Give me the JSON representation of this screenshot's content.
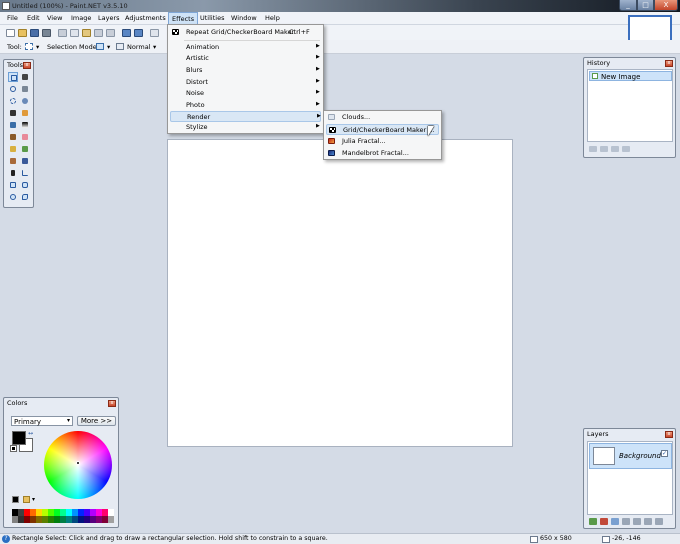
{
  "window": {
    "title": "Untitled (100%) - Paint.NET v3.5.10",
    "buttons": {
      "minimize": "_",
      "maximize": "□",
      "close": "X"
    }
  },
  "menubar": {
    "items": [
      "File",
      "Edit",
      "View",
      "Image",
      "Layers",
      "Adjustments",
      "Effects",
      "Utilities",
      "Window",
      "Help"
    ]
  },
  "toolbar": {
    "tool_label": "Tool:",
    "selection_mode_label": "Selection Mode:",
    "blend_mode": "Normal"
  },
  "effects_menu": {
    "repeat_label": "Repeat Grid/CheckerBoard Maker",
    "repeat_shortcut": "Ctrl+F",
    "items": [
      "Animation",
      "Artistic",
      "Blurs",
      "Distort",
      "Noise",
      "Photo",
      "Render",
      "Stylize"
    ],
    "highlighted": "Render"
  },
  "render_submenu": {
    "items": [
      "Clouds...",
      "Grid/CheckerBoard Maker ...",
      "Julia Fractal...",
      "Mandelbrot Fractal..."
    ],
    "highlighted": "Grid/CheckerBoard Maker ..."
  },
  "tools_panel": {
    "title": "Tools"
  },
  "history_panel": {
    "title": "History",
    "items": [
      "New Image"
    ]
  },
  "colors_panel": {
    "title": "Colors",
    "mode_select": "Primary",
    "more_button": "More >>",
    "primary_color": "#000000",
    "secondary_color": "#ffffff"
  },
  "layers_panel": {
    "title": "Layers",
    "layers": [
      {
        "name": "Background",
        "visible": true
      }
    ]
  },
  "statusbar": {
    "help_text": "Rectangle Select: Click and drag to draw a rectangular selection. Hold shift to constrain to a square.",
    "image_size": "650 x 580",
    "cursor_coords": "-26, -146"
  },
  "colors": {
    "accent": "#3b6fbf",
    "menu_highlight": "#d9e7f5",
    "workspace": "#d4dbe6"
  }
}
